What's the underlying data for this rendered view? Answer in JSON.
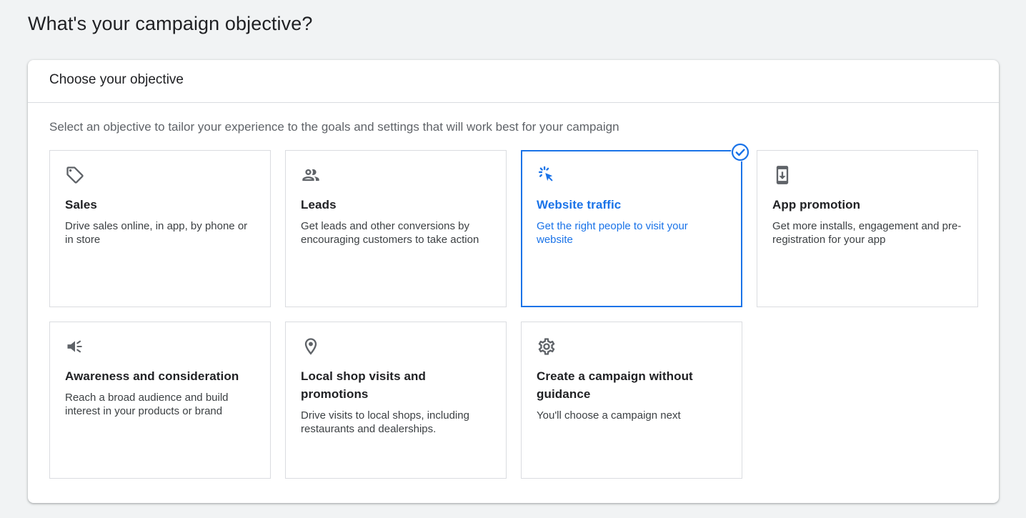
{
  "page": {
    "title": "What's your campaign objective?"
  },
  "card": {
    "header_title": "Choose your objective",
    "subtitle": "Select an objective to tailor your experience to the goals and settings that will work best for your campaign"
  },
  "objectives": [
    {
      "icon": "tag-icon",
      "title": "Sales",
      "description": "Drive sales online, in app, by phone or in store",
      "selected": false
    },
    {
      "icon": "people-icon",
      "title": "Leads",
      "description": "Get leads and other conversions by encouraging customers to take action",
      "selected": false
    },
    {
      "icon": "cursor-click-icon",
      "title": "Website traffic",
      "description": "Get the right people to visit your website",
      "selected": true
    },
    {
      "icon": "phone-download-icon",
      "title": "App promotion",
      "description": "Get more installs, engagement and pre-registration for your app",
      "selected": false
    },
    {
      "icon": "megaphone-icon",
      "title": "Awareness and consideration",
      "description": "Reach a broad audience and build interest in your products or brand",
      "selected": false
    },
    {
      "icon": "location-pin-icon",
      "title": "Local shop visits and promotions",
      "description": "Drive visits to local shops, including restaurants and dealerships.",
      "selected": false
    },
    {
      "icon": "gear-icon",
      "title": "Create a campaign without guidance",
      "description": "You'll choose a campaign next",
      "selected": false
    }
  ],
  "colors": {
    "accent": "#1a73e8",
    "icon_gray": "#5f6368",
    "page_background": "#f1f3f4"
  }
}
